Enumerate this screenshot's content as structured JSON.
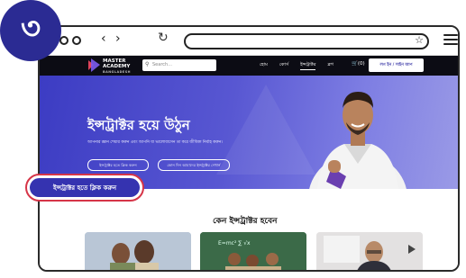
{
  "step_badge": "৩",
  "browser": {
    "back_icon": "chevron-left-icon",
    "forward_icon": "chevron-right-icon",
    "reload_icon": "reload-icon",
    "bookmark_icon": "star-icon",
    "menu_icon": "hamburger-icon"
  },
  "site": {
    "logo_line1": "MASTER",
    "logo_line2": "ACADEMY",
    "logo_sub": "BANGLADESH",
    "search_placeholder": "Search...",
    "menu": [
      "হোম",
      "কোর্স",
      "ইন্সট্রাক্টর",
      "ব্লগ"
    ],
    "cart_count": "(0)",
    "login_label": "লগ ইন / সাইন আপ"
  },
  "hero": {
    "title": "ইন্সট্রাক্টর হয়ে উঠুন",
    "subtitle": "আপনার জ্ঞান শেয়ার করুন এবং আপনি যা ভালোবাসেন তা করে জীবিকা নির্বাহ করুন।",
    "primary_button": "ইন্সট্রাক্টর হতে ক্লিক করুন",
    "secondary_button": "কোন দিন আমাদের ইন্সট্রাক্টর দেখার্ন"
  },
  "section": {
    "title": "কেন ইন্সট্রাক্টর হবেন"
  },
  "callout": {
    "label": "ইন্সট্রাক্টর হতে ক্লিক করুন"
  },
  "colors": {
    "brand": "#3533b0",
    "callout_border": "#d63548",
    "nav_bg": "#0c0c14"
  }
}
